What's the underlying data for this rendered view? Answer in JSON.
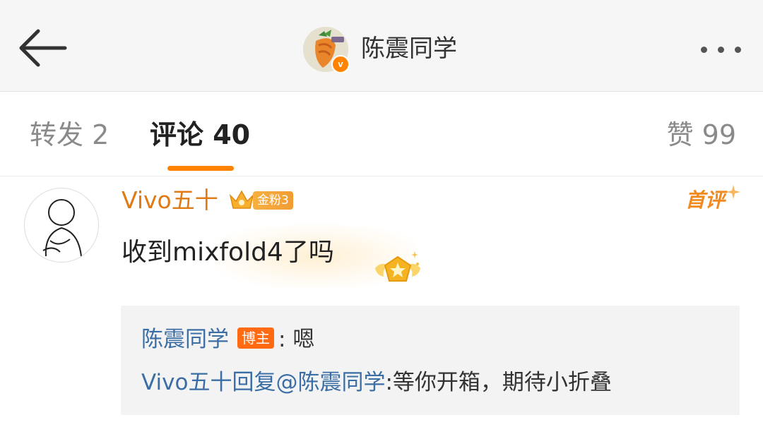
{
  "header": {
    "title": "陈震同学",
    "verified_mark": "v"
  },
  "tabs": {
    "repost": "转发 2",
    "comment": "评论 40",
    "like": "赞 99"
  },
  "comment": {
    "username": "Vivo五十",
    "fan_badge": "金粉3",
    "first_badge": "首评",
    "text": "收到mixfold4了吗"
  },
  "replies": {
    "author_name": "陈震同学",
    "author_tag": "博主",
    "author_separator": ":",
    "author_text": "嗯",
    "reply_user": "Vivo五十",
    "reply_action": "回复",
    "reply_target": "@陈震同学",
    "reply_separator": ":",
    "reply_text": "等你开箱，期待小折叠"
  },
  "colors": {
    "accent": "#ff8200",
    "username": "#e07a14",
    "link": "#3b6ea5",
    "blogger_tag": "#ff6a13"
  }
}
